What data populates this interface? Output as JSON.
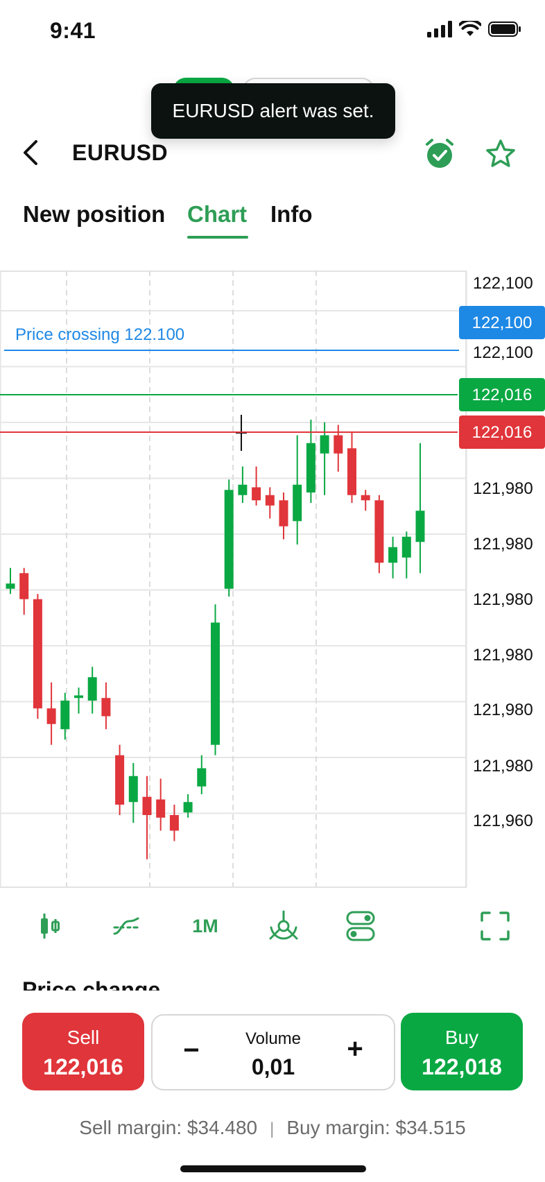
{
  "status_bar": {
    "time": "9:41"
  },
  "toast": {
    "message": "EURUSD alert was set."
  },
  "header": {
    "title": "EURUSD",
    "back_icon": "chevron-left-icon",
    "alarm_icon": "alarm-check-icon",
    "star_icon": "star-outline-icon"
  },
  "tabs": [
    {
      "label": "New position",
      "active": false
    },
    {
      "label": "Chart",
      "active": true
    },
    {
      "label": "Info",
      "active": false
    }
  ],
  "colors": {
    "accent": "#2e9e56",
    "sell": "#e0353a",
    "buy": "#0aa843",
    "alert_line": "#1e88e5"
  },
  "chart_data": {
    "type": "candlestick",
    "y_axis_labels": [
      "122,100",
      "122,100",
      "121,980",
      "121,980",
      "121,980",
      "121,980",
      "121,980",
      "121,980",
      "121,960"
    ],
    "alert": {
      "label": "Price crossing 122.100",
      "value_tag": "122,100"
    },
    "buy_line_tag": "122,016",
    "sell_line_tag": "122,016",
    "candles": [
      {
        "o": 0.295,
        "c": 0.305,
        "h": 0.335,
        "l": 0.285,
        "dir": "up"
      },
      {
        "o": 0.325,
        "c": 0.275,
        "h": 0.335,
        "l": 0.245,
        "dir": "down"
      },
      {
        "o": 0.275,
        "c": 0.065,
        "h": 0.285,
        "l": 0.045,
        "dir": "down"
      },
      {
        "o": 0.065,
        "c": 0.035,
        "h": 0.115,
        "l": -0.005,
        "dir": "down"
      },
      {
        "o": 0.025,
        "c": 0.08,
        "h": 0.095,
        "l": 0.005,
        "dir": "up"
      },
      {
        "o": 0.085,
        "c": 0.09,
        "h": 0.105,
        "l": 0.055,
        "dir": "up"
      },
      {
        "o": 0.08,
        "c": 0.125,
        "h": 0.145,
        "l": 0.055,
        "dir": "up"
      },
      {
        "o": 0.085,
        "c": 0.05,
        "h": 0.115,
        "l": 0.025,
        "dir": "down"
      },
      {
        "o": -0.025,
        "c": -0.12,
        "h": -0.005,
        "l": -0.14,
        "dir": "down"
      },
      {
        "o": -0.115,
        "c": -0.065,
        "h": -0.04,
        "l": -0.155,
        "dir": "up"
      },
      {
        "o": -0.105,
        "c": -0.14,
        "h": -0.065,
        "l": -0.225,
        "dir": "down"
      },
      {
        "o": -0.11,
        "c": -0.145,
        "h": -0.07,
        "l": -0.17,
        "dir": "down"
      },
      {
        "o": -0.14,
        "c": -0.17,
        "h": -0.12,
        "l": -0.19,
        "dir": "down"
      },
      {
        "o": -0.135,
        "c": -0.115,
        "h": -0.1,
        "l": -0.145,
        "dir": "up"
      },
      {
        "o": -0.085,
        "c": -0.05,
        "h": -0.025,
        "l": -0.1,
        "dir": "up"
      },
      {
        "o": -0.005,
        "c": 0.23,
        "h": 0.265,
        "l": -0.025,
        "dir": "up"
      },
      {
        "o": 0.295,
        "c": 0.485,
        "h": 0.505,
        "l": 0.28,
        "dir": "up"
      },
      {
        "o": 0.475,
        "c": 0.495,
        "h": 0.53,
        "l": 0.46,
        "dir": "up"
      },
      {
        "o": 0.49,
        "c": 0.465,
        "h": 0.53,
        "l": 0.455,
        "dir": "down"
      },
      {
        "o": 0.475,
        "c": 0.455,
        "h": 0.49,
        "l": 0.43,
        "dir": "down"
      },
      {
        "o": 0.465,
        "c": 0.415,
        "h": 0.48,
        "l": 0.39,
        "dir": "down"
      },
      {
        "o": 0.425,
        "c": 0.495,
        "h": 0.59,
        "l": 0.38,
        "dir": "up"
      },
      {
        "o": 0.48,
        "c": 0.575,
        "h": 0.62,
        "l": 0.46,
        "dir": "up"
      },
      {
        "o": 0.555,
        "c": 0.59,
        "h": 0.615,
        "l": 0.475,
        "dir": "up"
      },
      {
        "o": 0.59,
        "c": 0.555,
        "h": 0.61,
        "l": 0.52,
        "dir": "down"
      },
      {
        "o": 0.565,
        "c": 0.475,
        "h": 0.595,
        "l": 0.46,
        "dir": "down"
      },
      {
        "o": 0.475,
        "c": 0.465,
        "h": 0.485,
        "l": 0.445,
        "dir": "down"
      },
      {
        "o": 0.465,
        "c": 0.345,
        "h": 0.475,
        "l": 0.325,
        "dir": "down"
      },
      {
        "o": 0.345,
        "c": 0.375,
        "h": 0.395,
        "l": 0.315,
        "dir": "up"
      },
      {
        "o": 0.355,
        "c": 0.395,
        "h": 0.405,
        "l": 0.315,
        "dir": "up"
      },
      {
        "o": 0.385,
        "c": 0.445,
        "h": 0.575,
        "l": 0.325,
        "dir": "up"
      }
    ]
  },
  "toolbar": {
    "candles_icon": "candlestick-icon",
    "indicators_icon": "indicators-icon",
    "timeframe": "1M",
    "drawing_icon": "drawing-tools-icon",
    "settings_icon": "toggles-icon",
    "fullscreen_icon": "fullscreen-icon"
  },
  "price_change_heading": "Price change",
  "trade": {
    "sell_label": "Sell",
    "sell_price": "122,016",
    "volume_label": "Volume",
    "volume_value": "0,01",
    "minus": "−",
    "plus": "+",
    "buy_label": "Buy",
    "buy_price": "122,018",
    "sell_margin": "Sell margin: $34.480",
    "separator": "|",
    "buy_margin": "Buy margin: $34.515"
  }
}
